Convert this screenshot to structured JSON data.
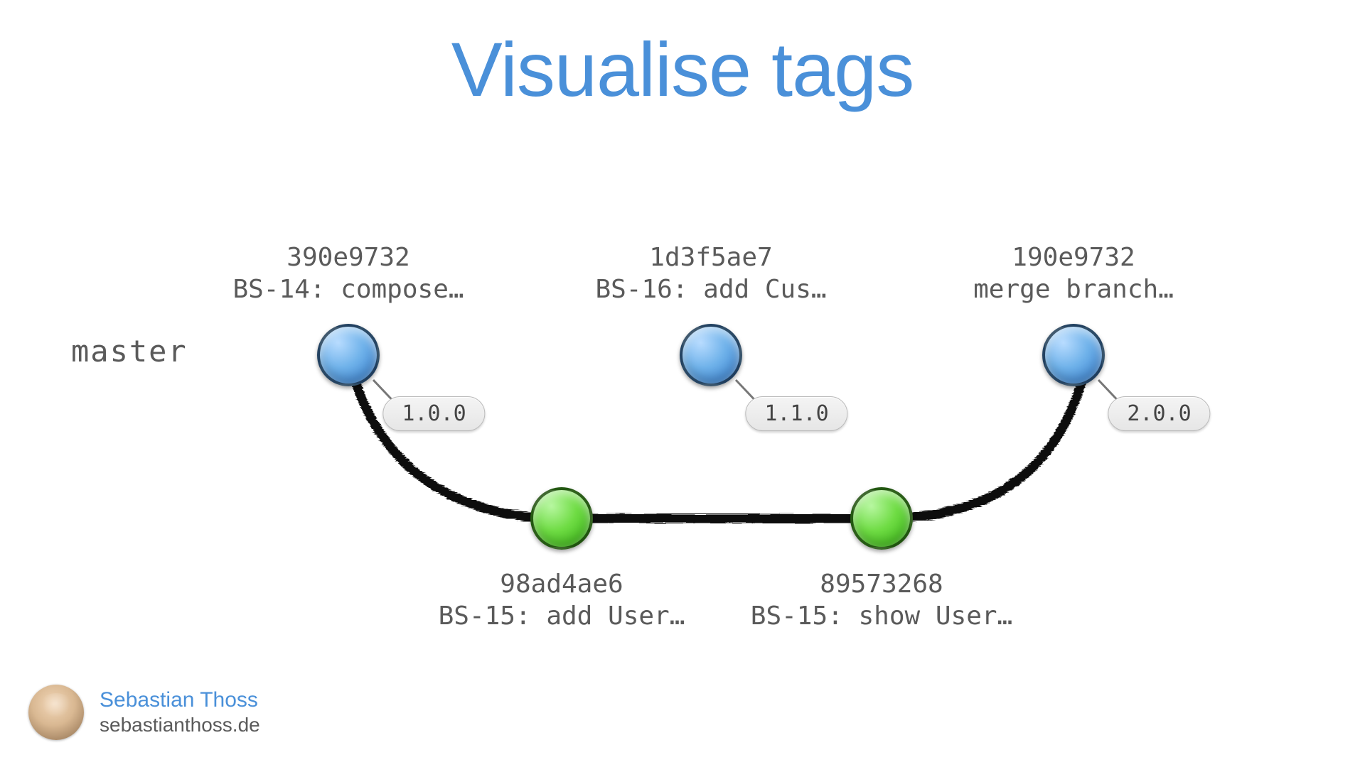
{
  "title": "Visualise tags",
  "branch": "master",
  "commits": {
    "c1": {
      "hash": "390e9732",
      "msg": "BS-14: compose…",
      "tag": "1.0.0"
    },
    "c2": {
      "hash": "1d3f5ae7",
      "msg": "BS-16: add Cus…",
      "tag": "1.1.0"
    },
    "c3": {
      "hash": "190e9732",
      "msg": "merge branch…",
      "tag": "2.0.0"
    },
    "c4": {
      "hash": "98ad4ae6",
      "msg": "BS-15: add User…"
    },
    "c5": {
      "hash": "89573268",
      "msg": "BS-15: show User…"
    }
  },
  "author": {
    "name": "Sebastian Thoss",
    "site": "sebastianthoss.de"
  },
  "colors": {
    "title": "#4a90d9",
    "master_node": "blue",
    "feature_node": "green"
  }
}
